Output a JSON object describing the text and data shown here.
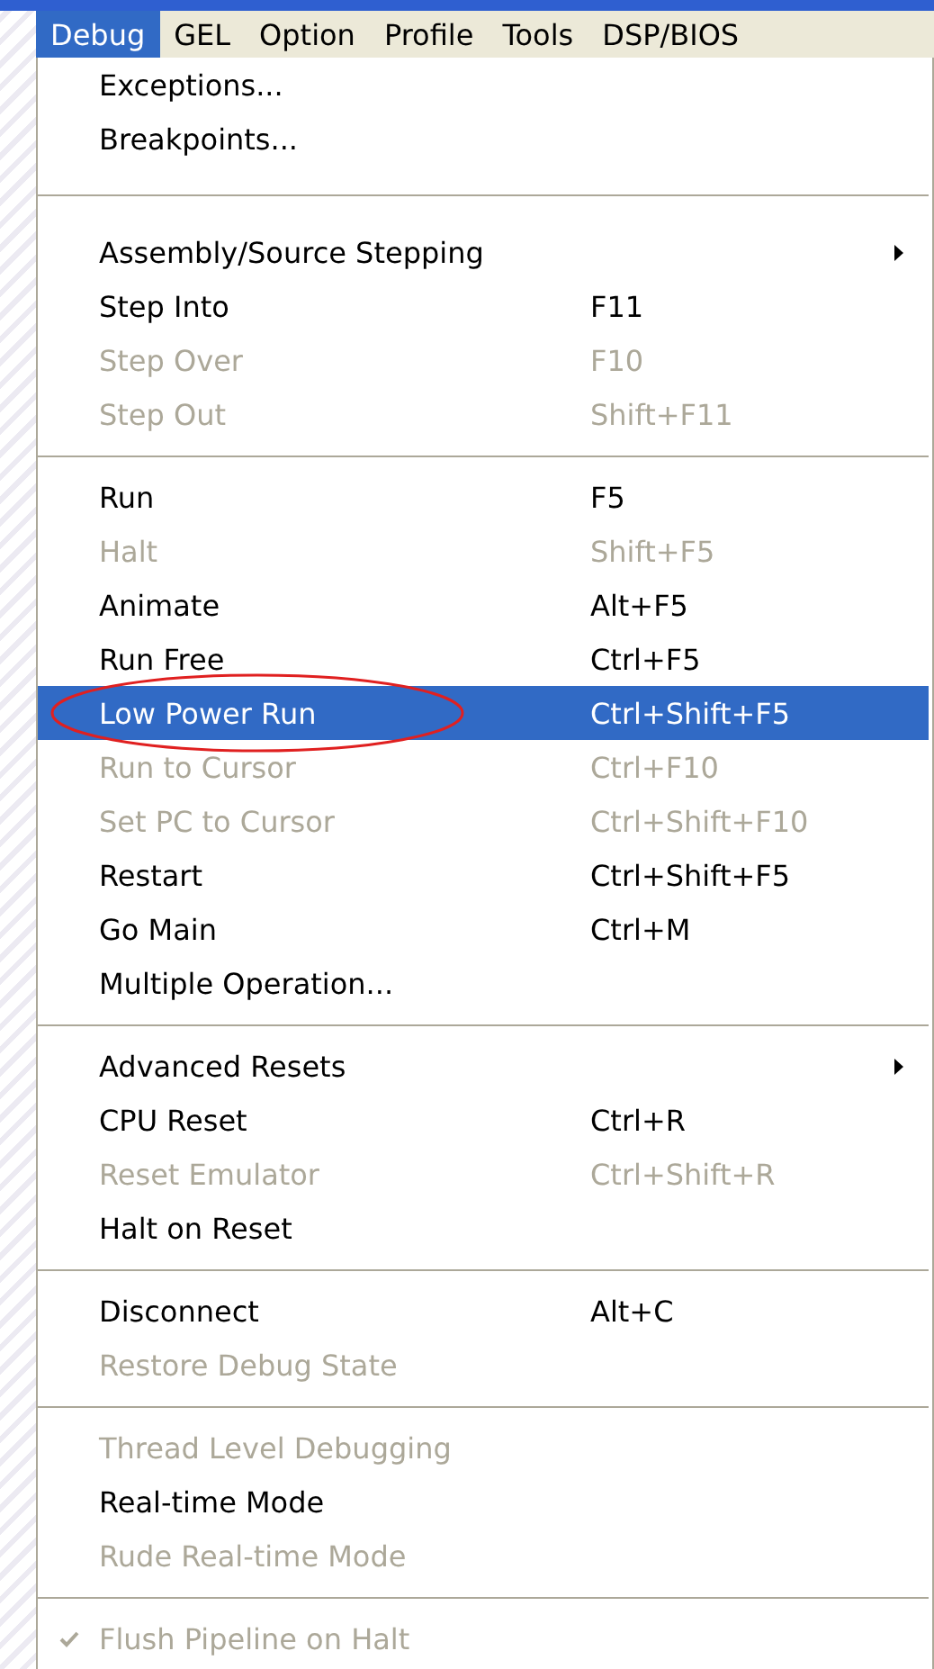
{
  "menubar": [
    {
      "label": "Debug",
      "selected": true
    },
    {
      "label": "GEL",
      "selected": false
    },
    {
      "label": "Option",
      "selected": false
    },
    {
      "label": "Profile",
      "selected": false
    },
    {
      "label": "Tools",
      "selected": false
    },
    {
      "label": "DSP/BIOS",
      "selected": false
    }
  ],
  "menu": [
    {
      "kind": "item",
      "label": "Exceptions...",
      "disabled": false,
      "selected": false
    },
    {
      "kind": "item",
      "label": "Breakpoints...",
      "disabled": false,
      "selected": false
    },
    {
      "kind": "separator"
    },
    {
      "kind": "item",
      "label": "Assembly/Source Stepping",
      "disabled": false,
      "selected": false,
      "submenu": true
    },
    {
      "kind": "item",
      "label": "Step Into",
      "shortcut": "F11",
      "disabled": false,
      "selected": false
    },
    {
      "kind": "item",
      "label": "Step Over",
      "shortcut": "F10",
      "disabled": true,
      "selected": false
    },
    {
      "kind": "item",
      "label": "Step Out",
      "shortcut": "Shift+F11",
      "disabled": true,
      "selected": false
    },
    {
      "kind": "separator"
    },
    {
      "kind": "item",
      "label": "Run",
      "shortcut": "F5",
      "disabled": false,
      "selected": false
    },
    {
      "kind": "item",
      "label": "Halt",
      "shortcut": "Shift+F5",
      "disabled": true,
      "selected": false
    },
    {
      "kind": "item",
      "label": "Animate",
      "shortcut": "Alt+F5",
      "disabled": false,
      "selected": false
    },
    {
      "kind": "item",
      "label": "Run Free",
      "shortcut": "Ctrl+F5",
      "disabled": false,
      "selected": false
    },
    {
      "kind": "item",
      "label": "Low Power Run",
      "shortcut": "Ctrl+Shift+F5",
      "disabled": false,
      "selected": true,
      "circled": true
    },
    {
      "kind": "item",
      "label": "Run to Cursor",
      "shortcut": "Ctrl+F10",
      "disabled": true,
      "selected": false
    },
    {
      "kind": "item",
      "label": "Set PC to Cursor",
      "shortcut": "Ctrl+Shift+F10",
      "disabled": true,
      "selected": false
    },
    {
      "kind": "item",
      "label": "Restart",
      "shortcut": "Ctrl+Shift+F5",
      "disabled": false,
      "selected": false
    },
    {
      "kind": "item",
      "label": "Go Main",
      "shortcut": "Ctrl+M",
      "disabled": false,
      "selected": false
    },
    {
      "kind": "item",
      "label": "Multiple Operation...",
      "disabled": false,
      "selected": false
    },
    {
      "kind": "separator"
    },
    {
      "kind": "item",
      "label": "Advanced Resets",
      "disabled": false,
      "selected": false,
      "submenu": true
    },
    {
      "kind": "item",
      "label": "CPU Reset",
      "shortcut": "Ctrl+R",
      "disabled": false,
      "selected": false
    },
    {
      "kind": "item",
      "label": "Reset Emulator",
      "shortcut": "Ctrl+Shift+R",
      "disabled": true,
      "selected": false
    },
    {
      "kind": "item",
      "label": "Halt on Reset",
      "disabled": false,
      "selected": false
    },
    {
      "kind": "separator"
    },
    {
      "kind": "item",
      "label": "Disconnect",
      "shortcut": "Alt+C",
      "disabled": false,
      "selected": false
    },
    {
      "kind": "item",
      "label": "Restore Debug State",
      "disabled": true,
      "selected": false
    },
    {
      "kind": "separator"
    },
    {
      "kind": "item",
      "label": "Thread Level Debugging",
      "disabled": true,
      "selected": false
    },
    {
      "kind": "item",
      "label": "Real-time Mode",
      "disabled": false,
      "selected": false
    },
    {
      "kind": "item",
      "label": "Rude Real-time Mode",
      "disabled": true,
      "selected": false
    },
    {
      "kind": "separator"
    },
    {
      "kind": "item",
      "label": "Flush Pipeline on Halt",
      "disabled": true,
      "selected": false,
      "checked": true
    }
  ]
}
